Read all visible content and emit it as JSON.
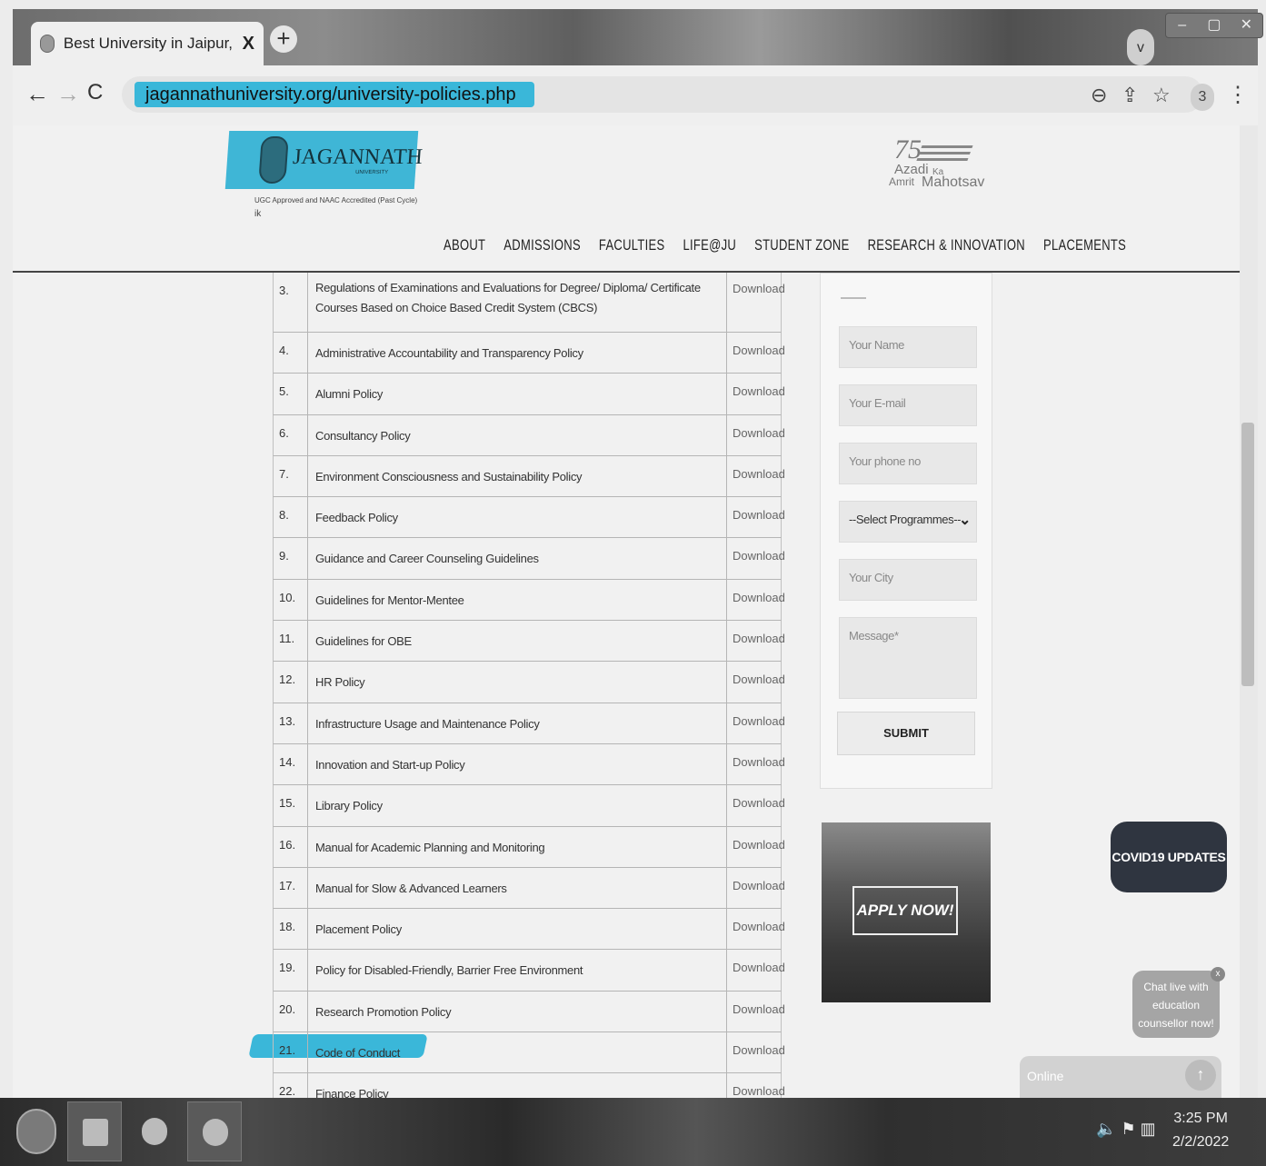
{
  "browser": {
    "tab_title": "Best University in Jaipur, Rajasth",
    "tab_close": "X",
    "new_tab": "+",
    "tab_search": "v",
    "url": "jagannathuniversity.org/university-policies.php",
    "profile_badge": "3"
  },
  "site": {
    "logo_name": "JAGANNATH",
    "logo_sub": "UNIVERSITY",
    "tagline": "UGC Approved and NAAC Accredited (Past Cycle)",
    "tagline2": "ik",
    "azadi_75": "75",
    "azadi_1": "Azadi",
    "azadi_2": "Ka",
    "azadi_3": "Amrit",
    "azadi_4": "Mahotsav"
  },
  "menu": [
    "ABOUT",
    "ADMISSIONS",
    "FACULTIES",
    "LIFE@JU",
    "STUDENT ZONE",
    "RESEARCH & INNOVATION",
    "PLACEMENTS"
  ],
  "policies": [
    {
      "num": "3.",
      "title": "Regulations of Examinations and Evaluations for Degree/ Diploma/ Certificate Courses Based on Choice Based Credit System (CBCS)",
      "action": "Download"
    },
    {
      "num": "4.",
      "title": "Administrative Accountability and Transparency Policy",
      "action": "Download"
    },
    {
      "num": "5.",
      "title": "Alumni Policy",
      "action": "Download"
    },
    {
      "num": "6.",
      "title": "Consultancy Policy",
      "action": "Download"
    },
    {
      "num": "7.",
      "title": "Environment Consciousness and Sustainability Policy",
      "action": "Download"
    },
    {
      "num": "8.",
      "title": "Feedback Policy",
      "action": "Download"
    },
    {
      "num": "9.",
      "title": "Guidance and Career Counseling Guidelines",
      "action": "Download"
    },
    {
      "num": "10.",
      "title": "Guidelines for Mentor-Mentee",
      "action": "Download"
    },
    {
      "num": "11.",
      "title": "Guidelines for OBE",
      "action": "Download"
    },
    {
      "num": "12.",
      "title": "HR Policy",
      "action": "Download"
    },
    {
      "num": "13.",
      "title": "Infrastructure Usage and Maintenance Policy",
      "action": "Download"
    },
    {
      "num": "14.",
      "title": "Innovation and Start-up Policy",
      "action": "Download"
    },
    {
      "num": "15.",
      "title": "Library Policy",
      "action": "Download"
    },
    {
      "num": "16.",
      "title": "Manual for Academic Planning and Monitoring",
      "action": "Download"
    },
    {
      "num": "17.",
      "title": "Manual for Slow & Advanced Learners",
      "action": "Download"
    },
    {
      "num": "18.",
      "title": "Placement Policy",
      "action": "Download"
    },
    {
      "num": "19.",
      "title": "Policy for Disabled-Friendly, Barrier Free Environment",
      "action": "Download"
    },
    {
      "num": "20.",
      "title": "Research Promotion Policy",
      "action": "Download"
    },
    {
      "num": "21.",
      "title": "Code of Conduct",
      "action": "Download",
      "highlighted": true
    },
    {
      "num": "22.",
      "title": "Finance Policy",
      "action": "Download"
    }
  ],
  "form": {
    "name_placeholder": "Your Name",
    "email_placeholder": "Your E-mail",
    "phone_placeholder": "Your phone no",
    "programme_select": "--Select Programmes--",
    "city_placeholder": "Your City",
    "message_placeholder": "Message*",
    "submit": "SUBMIT"
  },
  "apply_now": "APPLY NOW!",
  "covid_button": "COVID19 UPDATES",
  "chat": {
    "bubble": "Chat live with education counsellor now!",
    "close": "x",
    "input_placeholder": "Online",
    "send": "↑"
  },
  "taskbar": {
    "time": "3:25 PM",
    "date": "2/2/2022"
  },
  "colors": {
    "highlight": "#3ab7d9",
    "covid_bg": "#2f3540"
  }
}
